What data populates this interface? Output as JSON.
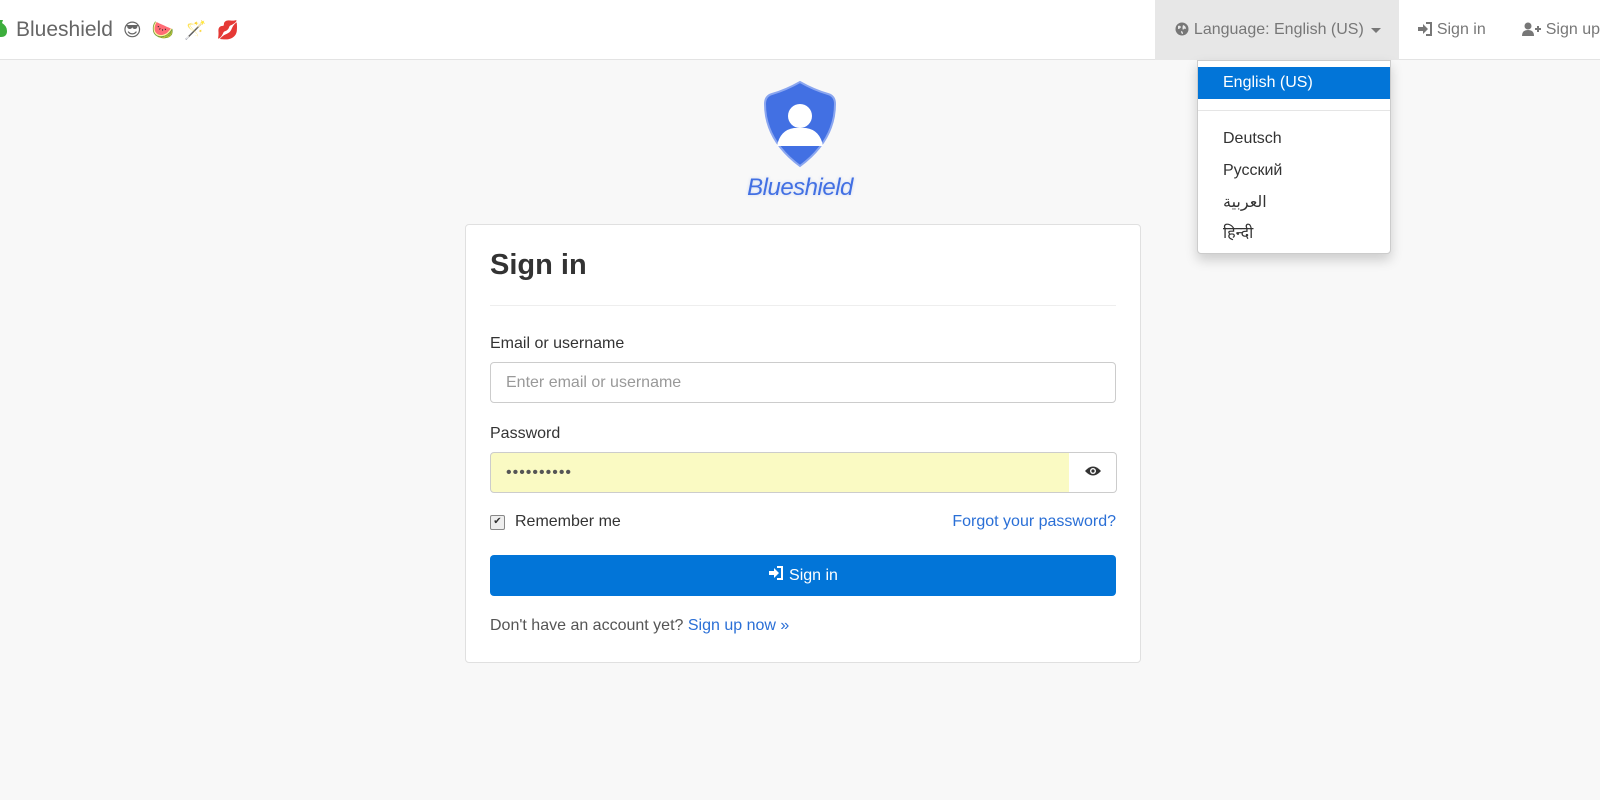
{
  "navbar": {
    "brand": "Blueshield",
    "brand_emojis": [
      "😎",
      "🍉",
      "🪄",
      "💋"
    ],
    "language_label": "Language: English (US)",
    "signin_label": "Sign in",
    "signup_label": "Sign up"
  },
  "language_menu": {
    "selected": "English (US)",
    "others": [
      "Deutsch",
      "Русский",
      "العربية",
      "हिन्दी"
    ],
    "accent": "#0275d8"
  },
  "logo": {
    "text": "Blueshield",
    "color": "#4270e3"
  },
  "form": {
    "title": "Sign in",
    "email_label": "Email or username",
    "email_placeholder": "Enter email or username",
    "password_label": "Password",
    "password_value": "••••••••••",
    "remember_label": "Remember me",
    "remember_checked": true,
    "forgot_label": "Forgot your password?",
    "submit_label": "Sign in",
    "no_account_text": "Don't have an account yet?",
    "signup_link": "Sign up now »"
  },
  "icons": {
    "brand": "money-bag-icon",
    "language": "globe-icon",
    "signin": "sign-in-icon",
    "signup": "user-plus-icon",
    "show_password": "eye-icon"
  }
}
